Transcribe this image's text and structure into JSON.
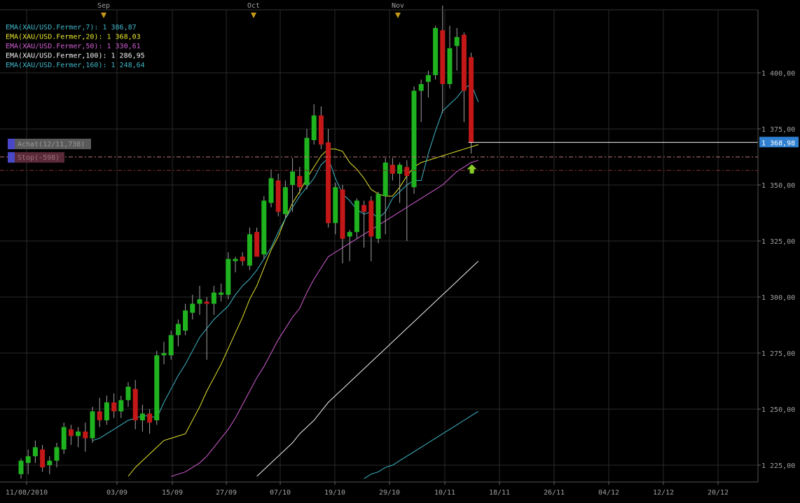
{
  "chart_data": {
    "type": "candlestick",
    "instrument": "XAU/USD",
    "colors": {
      "background": "#000000",
      "grid": "#2a2a2a",
      "axis_text": "#a0a0a0",
      "up_candle": "#1fb31f",
      "down_candle": "#c41818",
      "wick": "#a0a0a0",
      "current_price_bg": "#2f7fd0",
      "signal_arrow": "#8ccf2a"
    },
    "x_axis": {
      "tick_labels": [
        "11/08/2010",
        "03/09",
        "15/09",
        "27/09",
        "07/10",
        "19/10",
        "29/10",
        "10/11",
        "18/11",
        "26/11",
        "04/12",
        "12/12",
        "20/12"
      ],
      "tick_dates": [
        "2010-08-11",
        "2010-09-03",
        "2010-09-15",
        "2010-09-27",
        "2010-10-07",
        "2010-10-19",
        "2010-10-29",
        "2010-11-10",
        "2010-11-18",
        "2010-11-26",
        "2010-12-04",
        "2010-12-12",
        "2010-12-20"
      ],
      "month_markers": [
        "Sep",
        "Oct",
        "Nov"
      ]
    },
    "y_axis": {
      "ylim": [
        1215,
        1432
      ],
      "tick_labels": [
        "1 225,00",
        "1 250,00",
        "1 275,00",
        "1 300,00",
        "1 325,00",
        "1 350,00",
        "1 375,00",
        "1 400,00"
      ],
      "tick_values": [
        1225,
        1250,
        1275,
        1300,
        1325,
        1350,
        1375,
        1400
      ]
    },
    "current_price": {
      "value": 1368.98,
      "label": "1 368,98"
    },
    "legend": [
      {
        "label": "EMA(XAU/USD.Fermer,7):",
        "value": "1 386,87",
        "color": "#3fb6c8"
      },
      {
        "label": "EMA(XAU/USD.Fermer,20):",
        "value": "1 368,03",
        "color": "#e6e62e"
      },
      {
        "label": "EMA(XAU/USD.Fermer,50):",
        "value": "1 330,61",
        "color": "#d25ed2"
      },
      {
        "label": "EMA(XAU/USD.Fermer,100):",
        "value": "1 286,95",
        "color": "#f2f2f2"
      },
      {
        "label": "EMA(XAU/USD.Fermer,160):",
        "value": "1 248,64",
        "color": "#3fb6c8"
      }
    ],
    "orders": [
      {
        "label": "Achat(12/11,738)",
        "value": 1362.5,
        "bg": "#5a5a5a",
        "text_color": "#9a9a9a",
        "line_color": "#c07a7a"
      },
      {
        "label": "Stop(-598)",
        "value": 1356.5,
        "bg": "#5a2a38",
        "text_color": "#9a7080",
        "line_color": "#8a3030"
      }
    ],
    "signal": {
      "type": "up-arrow",
      "value": 1357
    },
    "candles": [
      {
        "o": 1221,
        "h": 1228,
        "l": 1219,
        "c": 1227
      },
      {
        "o": 1226,
        "h": 1232,
        "l": 1221,
        "c": 1229
      },
      {
        "o": 1229,
        "h": 1236,
        "l": 1226,
        "c": 1233
      },
      {
        "o": 1232,
        "h": 1234,
        "l": 1222,
        "c": 1224
      },
      {
        "o": 1225,
        "h": 1229,
        "l": 1221,
        "c": 1227
      },
      {
        "o": 1227,
        "h": 1235,
        "l": 1224,
        "c": 1233
      },
      {
        "o": 1232,
        "h": 1244,
        "l": 1230,
        "c": 1242
      },
      {
        "o": 1241,
        "h": 1243,
        "l": 1234,
        "c": 1238
      },
      {
        "o": 1238,
        "h": 1242,
        "l": 1233,
        "c": 1240
      },
      {
        "o": 1240,
        "h": 1244,
        "l": 1231,
        "c": 1237
      },
      {
        "o": 1237,
        "h": 1251,
        "l": 1235,
        "c": 1249
      },
      {
        "o": 1249,
        "h": 1255,
        "l": 1242,
        "c": 1245
      },
      {
        "o": 1245,
        "h": 1256,
        "l": 1243,
        "c": 1253
      },
      {
        "o": 1253,
        "h": 1257,
        "l": 1246,
        "c": 1249
      },
      {
        "o": 1249,
        "h": 1256,
        "l": 1246,
        "c": 1254
      },
      {
        "o": 1254,
        "h": 1262,
        "l": 1251,
        "c": 1260
      },
      {
        "o": 1259,
        "h": 1263,
        "l": 1241,
        "c": 1245
      },
      {
        "o": 1245,
        "h": 1252,
        "l": 1240,
        "c": 1248
      },
      {
        "o": 1248,
        "h": 1250,
        "l": 1239,
        "c": 1244
      },
      {
        "o": 1245,
        "h": 1276,
        "l": 1243,
        "c": 1274
      },
      {
        "o": 1274,
        "h": 1280,
        "l": 1270,
        "c": 1275
      },
      {
        "o": 1274,
        "h": 1285,
        "l": 1272,
        "c": 1283
      },
      {
        "o": 1283,
        "h": 1290,
        "l": 1278,
        "c": 1288
      },
      {
        "o": 1285,
        "h": 1297,
        "l": 1283,
        "c": 1294
      },
      {
        "o": 1293,
        "h": 1301,
        "l": 1290,
        "c": 1297
      },
      {
        "o": 1297,
        "h": 1305,
        "l": 1292,
        "c": 1299
      },
      {
        "o": 1298,
        "h": 1300,
        "l": 1272,
        "c": 1297
      },
      {
        "o": 1297,
        "h": 1305,
        "l": 1292,
        "c": 1302
      },
      {
        "o": 1301,
        "h": 1306,
        "l": 1298,
        "c": 1302
      },
      {
        "o": 1301,
        "h": 1320,
        "l": 1299,
        "c": 1317
      },
      {
        "o": 1316,
        "h": 1318,
        "l": 1311,
        "c": 1317
      },
      {
        "o": 1318,
        "h": 1320,
        "l": 1314,
        "c": 1316
      },
      {
        "o": 1314,
        "h": 1331,
        "l": 1312,
        "c": 1328
      },
      {
        "o": 1329,
        "h": 1331,
        "l": 1318,
        "c": 1318
      },
      {
        "o": 1319,
        "h": 1345,
        "l": 1317,
        "c": 1343
      },
      {
        "o": 1342,
        "h": 1357,
        "l": 1340,
        "c": 1353
      },
      {
        "o": 1352,
        "h": 1355,
        "l": 1336,
        "c": 1338
      },
      {
        "o": 1337,
        "h": 1352,
        "l": 1335,
        "c": 1349
      },
      {
        "o": 1350,
        "h": 1362,
        "l": 1338,
        "c": 1356
      },
      {
        "o": 1354,
        "h": 1358,
        "l": 1346,
        "c": 1349
      },
      {
        "o": 1350,
        "h": 1375,
        "l": 1348,
        "c": 1371
      },
      {
        "o": 1370,
        "h": 1386,
        "l": 1368,
        "c": 1381
      },
      {
        "o": 1381,
        "h": 1385,
        "l": 1366,
        "c": 1368
      },
      {
        "o": 1369,
        "h": 1375,
        "l": 1331,
        "c": 1333
      },
      {
        "o": 1333,
        "h": 1351,
        "l": 1328,
        "c": 1349
      },
      {
        "o": 1348,
        "h": 1350,
        "l": 1315,
        "c": 1326
      },
      {
        "o": 1327,
        "h": 1330,
        "l": 1316,
        "c": 1329
      },
      {
        "o": 1329,
        "h": 1344,
        "l": 1326,
        "c": 1343
      },
      {
        "o": 1341,
        "h": 1343,
        "l": 1322,
        "c": 1338
      },
      {
        "o": 1343,
        "h": 1345,
        "l": 1316,
        "c": 1327
      },
      {
        "o": 1326,
        "h": 1347,
        "l": 1324,
        "c": 1346
      },
      {
        "o": 1345,
        "h": 1362,
        "l": 1328,
        "c": 1360
      },
      {
        "o": 1359,
        "h": 1362,
        "l": 1352,
        "c": 1355
      },
      {
        "o": 1355,
        "h": 1360,
        "l": 1342,
        "c": 1359
      },
      {
        "o": 1358,
        "h": 1361,
        "l": 1325,
        "c": 1354
      },
      {
        "o": 1349,
        "h": 1394,
        "l": 1346,
        "c": 1392
      },
      {
        "o": 1392,
        "h": 1397,
        "l": 1378,
        "c": 1395
      },
      {
        "o": 1396,
        "h": 1401,
        "l": 1389,
        "c": 1399
      },
      {
        "o": 1399,
        "h": 1421,
        "l": 1397,
        "c": 1420
      },
      {
        "o": 1419,
        "h": 1430,
        "l": 1382,
        "c": 1395
      },
      {
        "o": 1395,
        "h": 1421,
        "l": 1393,
        "c": 1411
      },
      {
        "o": 1412,
        "h": 1420,
        "l": 1401,
        "c": 1416
      },
      {
        "o": 1417,
        "h": 1418,
        "l": 1378,
        "c": 1392
      },
      {
        "o": 1407,
        "h": 1409,
        "l": 1364,
        "c": 1369
      }
    ],
    "ema": {
      "ema7": [
        null,
        null,
        null,
        null,
        null,
        null,
        null,
        null,
        null,
        null,
        1236,
        1237,
        1239,
        1241,
        1243,
        1245,
        1246,
        1247,
        1247,
        1246,
        1253,
        1259,
        1265,
        1270,
        1276,
        1282,
        1286,
        1290,
        1293,
        1296,
        1301,
        1305,
        1308,
        1312,
        1317,
        1322,
        1329,
        1335,
        1340,
        1345,
        1349,
        1353,
        1359,
        1362,
        1353,
        1346,
        1343,
        1339,
        1337,
        1338,
        1335,
        1338,
        1344,
        1347,
        1350,
        1352,
        1352,
        1364,
        1374,
        1383,
        1386,
        1389,
        1393,
        1395,
        1387
      ],
      "ema20": [
        null,
        null,
        null,
        null,
        null,
        null,
        null,
        null,
        null,
        null,
        null,
        null,
        null,
        null,
        null,
        1220,
        1224,
        1227,
        1230,
        1233,
        1236,
        1237,
        1238,
        1239,
        1245,
        1251,
        1258,
        1264,
        1270,
        1277,
        1284,
        1291,
        1299,
        1305,
        1313,
        1321,
        1327,
        1335,
        1342,
        1347,
        1353,
        1358,
        1363,
        1366,
        1366,
        1365,
        1360,
        1357,
        1353,
        1348,
        1346,
        1345,
        1345,
        1349,
        1354,
        1358,
        1360,
        1361,
        1362,
        1363,
        1364,
        1365,
        1366,
        1367,
        1368
      ],
      "ema50": [
        null,
        null,
        null,
        null,
        null,
        null,
        null,
        null,
        null,
        null,
        null,
        null,
        null,
        null,
        null,
        null,
        null,
        null,
        null,
        null,
        null,
        1220,
        1221,
        1222,
        1224,
        1226,
        1229,
        1233,
        1237,
        1241,
        1246,
        1252,
        1258,
        1264,
        1269,
        1275,
        1281,
        1286,
        1291,
        1295,
        1302,
        1308,
        1313,
        1318,
        1320,
        1322,
        1324,
        1326,
        1328,
        1330,
        1332,
        1334,
        1336,
        1338,
        1340,
        1342,
        1344,
        1346,
        1348,
        1350,
        1353,
        1356,
        1358,
        1360,
        1361
      ],
      "ema100": [
        null,
        null,
        null,
        null,
        null,
        null,
        null,
        null,
        null,
        null,
        null,
        null,
        null,
        null,
        null,
        null,
        null,
        null,
        null,
        null,
        null,
        null,
        null,
        null,
        null,
        null,
        null,
        null,
        null,
        null,
        null,
        null,
        null,
        1220,
        1223,
        1226,
        1229,
        1232,
        1235,
        1239,
        1242,
        1245,
        1249,
        1253,
        1256,
        1259,
        1262,
        1265,
        1268,
        1271,
        1274,
        1277,
        1280,
        1283,
        1286,
        1289,
        1292,
        1295,
        1298,
        1301,
        1304,
        1307,
        1310,
        1313,
        1316
      ],
      "ema160": [
        null,
        null,
        null,
        null,
        null,
        null,
        null,
        null,
        null,
        null,
        null,
        null,
        null,
        null,
        null,
        null,
        null,
        null,
        null,
        null,
        null,
        null,
        null,
        null,
        null,
        null,
        null,
        null,
        null,
        null,
        null,
        null,
        null,
        null,
        null,
        null,
        null,
        null,
        null,
        null,
        null,
        null,
        null,
        null,
        null,
        null,
        null,
        null,
        1219,
        1221,
        1222,
        1224,
        1225,
        1227,
        1229,
        1231,
        1233,
        1235,
        1237,
        1239,
        1241,
        1243,
        1245,
        1247,
        1249
      ]
    }
  }
}
